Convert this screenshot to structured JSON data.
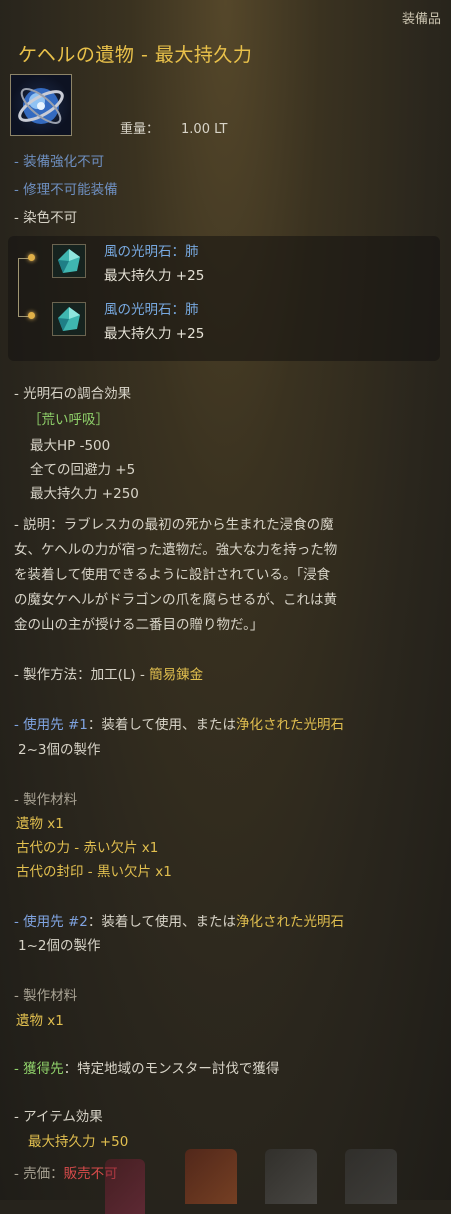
{
  "tooltip": {
    "category": "装備品",
    "title": "ケヘルの遺物 - 最大持久力",
    "icon": "blue-relic-orb-icon",
    "weight_label": "重量：",
    "weight_value": "1.00 LT",
    "flags": [
      "- 装備強化不可",
      "- 修理不可能装備",
      "- 染色不可"
    ],
    "sockets": [
      {
        "name": "風の光明石：肺",
        "stat": "最大持久力 +25"
      },
      {
        "name": "風の光明石：肺",
        "stat": "最大持久力 +25"
      }
    ],
    "combo": {
      "label": "- 光明石の調合効果",
      "name": "［荒い呼吸］",
      "stats": [
        "最大HP -500",
        "全ての回避力 +5",
        "最大持久力 +250"
      ]
    },
    "description": {
      "lines": [
        "- 説明：ラブレスカの最初の死から生まれた浸食の魔",
        "女、ケヘルの力が宿った遺物だ。強大な力を持った物",
        "を装着して使用できるように設計されている。「浸食",
        "の魔女ケヘルがドラゴンの爪を腐らせるが、これは黄",
        "金の山の主が授ける二番目の贈り物だ。」"
      ]
    },
    "craft_method": {
      "prefix": "- 製作方法：加工(L) - ",
      "value": "簡易錬金"
    },
    "use1": {
      "prefix": "- 使用先 #1",
      "mid": "：装着して使用、または",
      "highlight": "浄化された光明石",
      "line2": "2~3個の製作"
    },
    "materials1": {
      "label": "- 製作材料",
      "items": [
        "遺物 x1",
        "古代の力 - 赤い欠片 x1",
        "古代の封印 - 黒い欠片 x1"
      ]
    },
    "use2": {
      "prefix": "- 使用先 #2",
      "mid": "：装着して使用、または",
      "highlight": "浄化された光明石",
      "line2": "1~2個の製作"
    },
    "materials2": {
      "label": "- 製作材料",
      "items": [
        "遺物 x1"
      ]
    },
    "obtain": {
      "prefix": "- 獲得先",
      "text": "：特定地域のモンスター討伐で獲得"
    },
    "item_effect": {
      "label": "- アイテム効果",
      "stat": "最大持久力 +50"
    },
    "sell": {
      "label": "- 売価：",
      "value": "販売不可"
    }
  },
  "colors": {
    "title": "#e9c14a",
    "blue_text": "#6e8fc0",
    "gem_name": "#78a9e0",
    "gold": "#e1bf4f",
    "green": "#8fd16a",
    "red": "#d94b4b"
  }
}
